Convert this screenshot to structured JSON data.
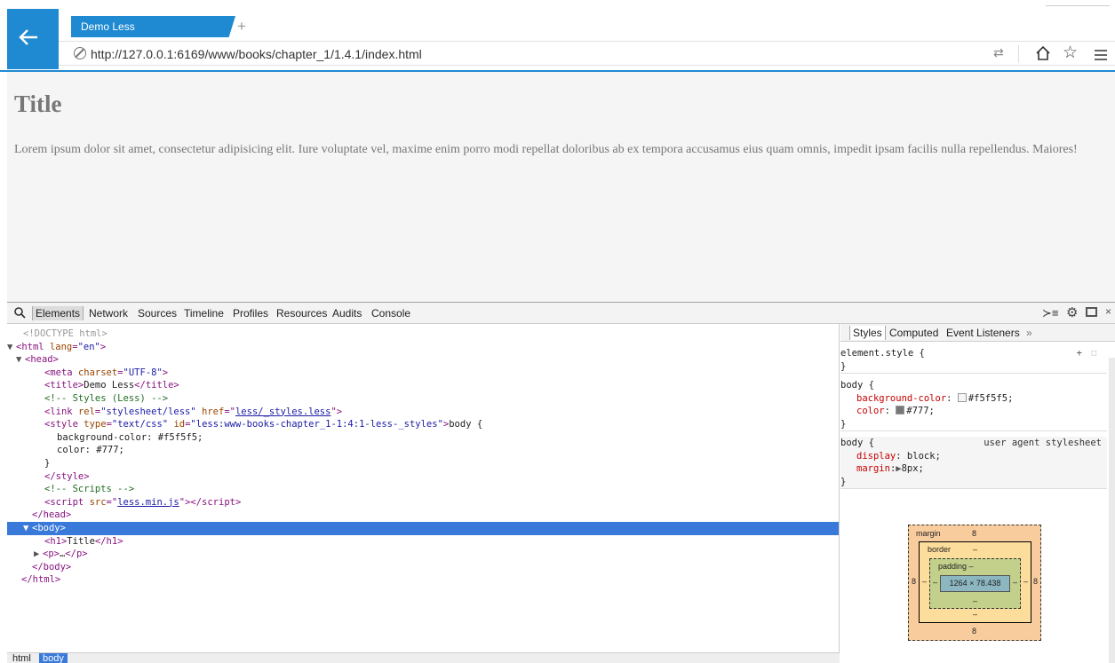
{
  "browser": {
    "tab_title": "Demo Less",
    "new_tab_symbol": "+",
    "url": "http://127.0.0.1:6169/www/books/chapter_1/1.4.1/index.html",
    "accent_color": "#1f8ad2",
    "icons": [
      "back-arrow-icon",
      "site-info-icon",
      "reload-icon",
      "home-icon",
      "favorite-star-icon",
      "hub-menu-icon"
    ]
  },
  "page": {
    "title": "Title",
    "paragraph": "Lorem ipsum dolor sit amet, consectetur adipisicing elit. Iure voluptate vel, maxime enim porro modi repellat doloribus ab ex tempora accusamus eius quam omnis, impedit ipsam facilis nulla repellendus. Maiores!",
    "background_color": "#f5f5f5",
    "text_color": "#777"
  },
  "devtools": {
    "tabs": [
      "Elements",
      "Network",
      "Sources",
      "Timeline",
      "Profiles",
      "Resources",
      "Audits",
      "Console"
    ],
    "active_tab": "Elements",
    "close_symbol": "×",
    "dom": {
      "doctype": "<!DOCTYPE html>",
      "html_open_tag": "html",
      "html_lang_attr": "lang",
      "html_lang_val": "\"en\"",
      "head_tag": "head",
      "meta_attr": "charset",
      "meta_val": "\"UTF-8\"",
      "title_text": "Demo Less",
      "comment_styles": "<!-- Styles (Less) -->",
      "link_rel_val": "\"stylesheet/less\"",
      "link_href": "less/_styles.less",
      "style_type_val": "\"text/css\"",
      "style_id_val": "\"less:www-books-chapter_1-1:4:1-less-_styles\"",
      "style_body_open": "body {",
      "style_bg": "background-color: #f5f5f5;",
      "style_color": "color: #777;",
      "style_close": "}",
      "comment_scripts": "<!-- Scripts -->",
      "script_src": "less.min.js",
      "h1_text": "Title",
      "p_ellipsis": "…"
    },
    "breadcrumb": [
      "html",
      "body"
    ],
    "styles_tabs": [
      "Styles",
      "Computed",
      "Event Listeners",
      "»"
    ],
    "styles": {
      "element_style": "element.style {",
      "close_brace": "}",
      "body_rule_selector": "body {",
      "body_bg_prop": "background-color",
      "body_bg_val": "#f5f5f5;",
      "body_bg_swatch": "#f5f5f5",
      "body_color_prop": "color",
      "body_color_val": "#777;",
      "body_color_swatch": "#777777",
      "ua_selector": "body {",
      "ua_label": "user agent stylesheet",
      "ua_display_prop": "display",
      "ua_display_val": "block;",
      "ua_margin_prop": "margin",
      "ua_margin_val": "8px;"
    },
    "box_model": {
      "margin_label": "margin",
      "margin_top": "8",
      "margin_right": "8",
      "margin_bottom": "8",
      "margin_left": "8",
      "border_label": "border",
      "border_top": "–",
      "border_right": "–",
      "border_bottom": "–",
      "border_left": "–",
      "padding_label": "padding –",
      "padding_bottom": "–",
      "padding_left": "–",
      "padding_right": "–",
      "content_size": "1264 × 78.438"
    }
  }
}
